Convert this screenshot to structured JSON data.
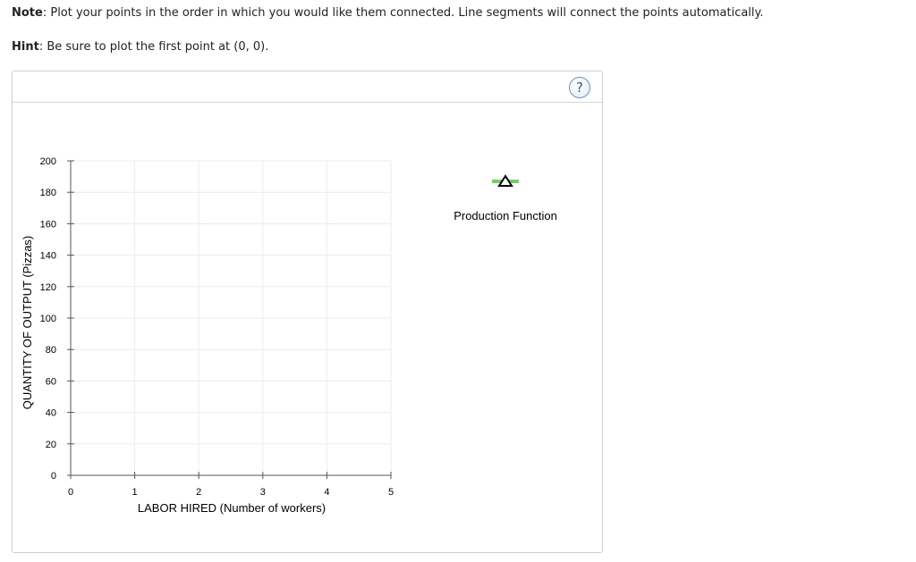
{
  "instructions": {
    "note_label": "Note",
    "note_text": ": Plot your points in the order in which you would like them connected. Line segments will connect the points automatically.",
    "hint_label": "Hint",
    "hint_text": ": Be sure to plot the first point at (0, 0)."
  },
  "help_button": {
    "label": "?"
  },
  "chart_data": {
    "type": "line",
    "xlabel": "LABOR HIRED (Number of workers)",
    "ylabel": "QUANTITY OF OUTPUT (Pizzas)",
    "xlim": [
      0,
      5
    ],
    "ylim": [
      0,
      200
    ],
    "xticks": [
      0,
      1,
      2,
      3,
      4,
      5
    ],
    "yticks": [
      0,
      20,
      40,
      60,
      80,
      100,
      120,
      140,
      160,
      180,
      200
    ],
    "grid": true,
    "series": [
      {
        "name": "Production Function",
        "x": [],
        "y": [],
        "color": "#77cc66",
        "marker": "triangle"
      }
    ],
    "legend": {
      "placement": "right"
    }
  }
}
